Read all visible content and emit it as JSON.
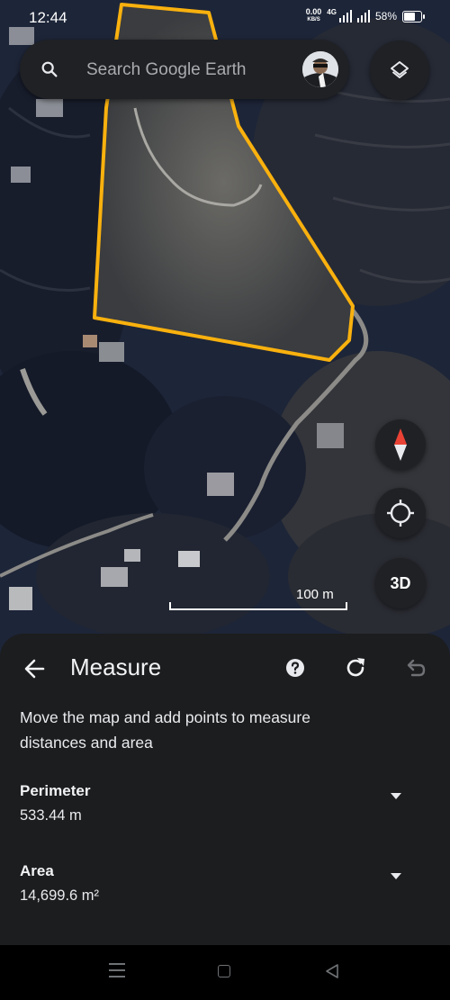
{
  "status_bar": {
    "time": "12:44",
    "net_speed_value": "0.00",
    "net_speed_unit": "KB/S",
    "network_type": "4G",
    "battery": "58%"
  },
  "search": {
    "placeholder": "Search Google Earth"
  },
  "map": {
    "scale_label": "100 m",
    "polygon_color": "#f9b10e"
  },
  "controls": {
    "view_3d_label": "3D"
  },
  "measure_panel": {
    "title": "Measure",
    "instructions": "Move the map and add points to measure distances and area",
    "perimeter": {
      "label": "Perimeter",
      "value": "533.44 m"
    },
    "area": {
      "label": "Area",
      "value": "14,699.6 m²"
    }
  },
  "icons": {
    "back": "arrow-left-icon",
    "help": "help-icon",
    "reset": "refresh-icon",
    "undo": "undo-icon",
    "layers": "layers-icon",
    "compass": "compass-icon",
    "locate": "my-location-icon"
  }
}
